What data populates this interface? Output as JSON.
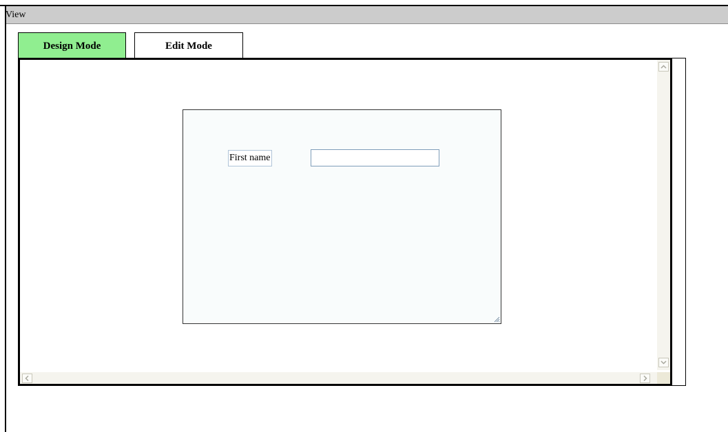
{
  "menubar": {
    "view_label": "View"
  },
  "tabs": [
    {
      "label": "Design Mode",
      "active": true,
      "color": "#90ee90"
    },
    {
      "label": "Edit Mode",
      "active": false,
      "color": "#ffffff"
    }
  ],
  "form": {
    "first_name_label": "First name",
    "first_name_value": ""
  },
  "scrollbars": {
    "up_icon": "scroll-up-icon",
    "down_icon": "scroll-down-icon",
    "left_icon": "scroll-left-icon",
    "right_icon": "scroll-right-icon"
  }
}
